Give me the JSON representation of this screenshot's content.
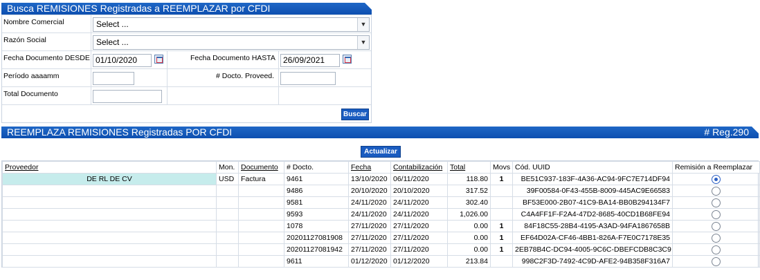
{
  "search_panel": {
    "title": "Busca REMISIONES Registradas a REEMPLAZAR por CFDI",
    "nombre_comercial_label": "Nombre Comercial",
    "nombre_comercial_value": "Select ...",
    "razon_social_label": "Razón Social",
    "razon_social_value": "Select ...",
    "fecha_desde_label": "Fecha Documento DESDE",
    "fecha_desde_value": "01/10/2020",
    "fecha_hasta_label": "Fecha Documento HASTA",
    "fecha_hasta_value": "26/09/2021",
    "periodo_label": "Período aaaamm",
    "periodo_value": "",
    "docto_prov_label": "# Docto. Proveed.",
    "docto_prov_value": "",
    "total_label": "Total Documento",
    "total_value": "",
    "buscar_label": "Buscar"
  },
  "results_panel": {
    "title": "REEMPLAZA REMISIONES Registradas POR CFDI",
    "count": "# Reg.290",
    "actualizar_label": "Actualizar",
    "columns": {
      "proveedor": "Proveedor",
      "mon": "Mon.",
      "documento": "Documento",
      "docto": "# Docto.",
      "fecha": "Fecha",
      "contabilizacion": "Contabilización",
      "total": "Total",
      "movs": "Movs",
      "uuid": "Cód. UUID",
      "remision": "Remisión a Reemplazar"
    },
    "rows": [
      {
        "proveedor": "DE RL DE CV",
        "mon": "USD",
        "documento": "Factura",
        "docto": "9461",
        "fecha": "13/10/2020",
        "contabilizacion": "06/11/2020",
        "total": "118.80",
        "movs": "1",
        "uuid": "BE51C937-183F-4A36-AC94-9FC7E714DF94",
        "selected": true
      },
      {
        "proveedor": "",
        "mon": "",
        "documento": "",
        "docto": "9486",
        "fecha": "20/10/2020",
        "contabilizacion": "20/10/2020",
        "total": "317.52",
        "movs": "",
        "uuid": "39F00584-0F43-455B-8009-445AC9E66583",
        "selected": false
      },
      {
        "proveedor": "",
        "mon": "",
        "documento": "",
        "docto": "9581",
        "fecha": "24/11/2020",
        "contabilizacion": "24/11/2020",
        "total": "302.40",
        "movs": "",
        "uuid": "BF53E000-2B07-41C9-BA14-BB0B294134F7",
        "selected": false
      },
      {
        "proveedor": "",
        "mon": "",
        "documento": "",
        "docto": "9593",
        "fecha": "24/11/2020",
        "contabilizacion": "24/11/2020",
        "total": "1,026.00",
        "movs": "",
        "uuid": "C4A4FF1F-F2A4-47D2-8685-40CD1B68FE94",
        "selected": false
      },
      {
        "proveedor": "",
        "mon": "",
        "documento": "",
        "docto": "1078",
        "fecha": "27/11/2020",
        "contabilizacion": "27/11/2020",
        "total": "0.00",
        "movs": "1",
        "uuid": "84F18C55-28B4-4195-A3AD-94FA1867658B",
        "selected": false
      },
      {
        "proveedor": "",
        "mon": "",
        "documento": "",
        "docto": "20201127081908",
        "fecha": "27/11/2020",
        "contabilizacion": "27/11/2020",
        "total": "0.00",
        "movs": "1",
        "uuid": "EF64D02A-CF46-4BB1-826A-F7E0C7178E35",
        "selected": false
      },
      {
        "proveedor": "",
        "mon": "",
        "documento": "",
        "docto": "20201127081942",
        "fecha": "27/11/2020",
        "contabilizacion": "27/11/2020",
        "total": "0.00",
        "movs": "1",
        "uuid": "2EB78B4C-DC94-4005-9C6C-DBEFCDB8C3C9",
        "selected": false
      },
      {
        "proveedor": "",
        "mon": "",
        "documento": "",
        "docto": "9611",
        "fecha": "01/12/2020",
        "contabilizacion": "01/12/2020",
        "total": "213.84",
        "movs": "",
        "uuid": "998C2F3D-7492-4C9D-AFE2-94B358F316A7",
        "selected": false
      }
    ]
  }
}
